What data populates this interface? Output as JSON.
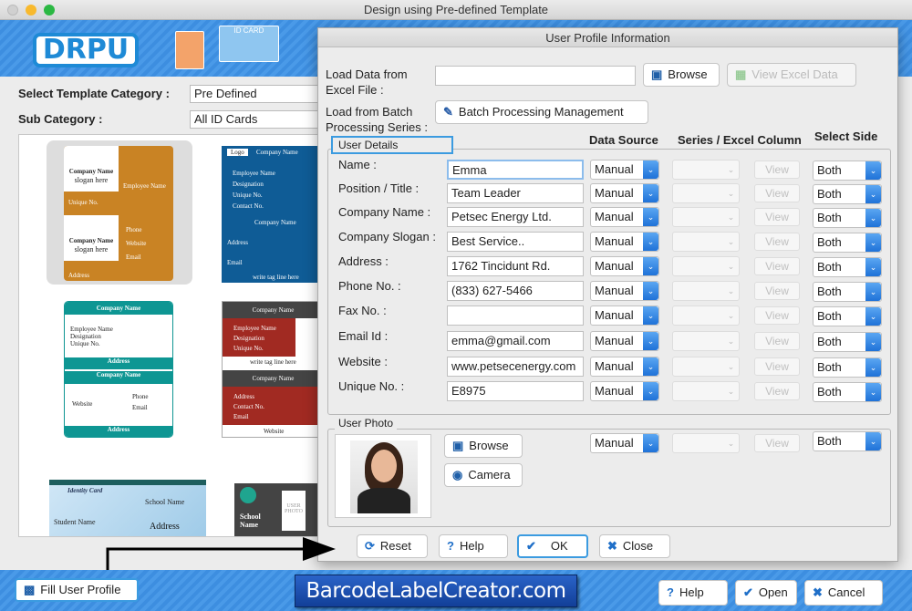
{
  "window": {
    "title": "Design using Pre-defined Template"
  },
  "brand": {
    "logo": "DRPU",
    "id_card_label": "ID CARD",
    "accent": "#1e8ad6"
  },
  "left": {
    "template_category_label": "Select Template Category :",
    "template_category_value": "Pre Defined",
    "sub_category_label": "Sub Category :",
    "sub_category_value": "All ID Cards",
    "templates": [
      {
        "lines": [
          "Company Name",
          "slogan here",
          "Employee Name",
          "Unique No.",
          "Designation",
          "Phone",
          "Website",
          "Email",
          "Address"
        ]
      },
      {
        "lines": [
          "Logo",
          "Company Name",
          "Employee Name",
          "Designation",
          "Unique No.",
          "Contact No.",
          "Address",
          "Email",
          "write tag line here"
        ]
      },
      {
        "lines": [
          "Company Name",
          "Employee Name",
          "Designation",
          "Unique No.",
          "Address",
          "Website",
          "Phone",
          "Email"
        ]
      },
      {
        "lines": [
          "Company Name",
          "Employee Name",
          "Designation",
          "Unique No.",
          "write tag line here",
          "Address",
          "Contact No.",
          "Email",
          "Website"
        ]
      },
      {
        "lines": [
          "Identity Card",
          "School Name",
          "Student Name",
          "Address"
        ]
      },
      {
        "lines": [
          "School Name",
          "USER PHOTO"
        ]
      }
    ]
  },
  "dialog": {
    "title": "User Profile Information",
    "excel_label": "Load Data from Excel File :",
    "excel_value": "",
    "browse_label": "Browse",
    "view_excel_label": "View Excel Data",
    "batch_label": "Load from Batch Processing Series :",
    "batch_button": "Batch Processing Management",
    "user_details_label": "User Details",
    "col_data_source": "Data Source",
    "col_series": "Series / Excel Column",
    "col_side": "Select Side",
    "view_label": "View",
    "fields": [
      {
        "label": "Name :",
        "value": "Emma",
        "source": "Manual",
        "side": "Both"
      },
      {
        "label": "Position / Title :",
        "value": "Team Leader",
        "source": "Manual",
        "side": "Both"
      },
      {
        "label": "Company Name :",
        "value": "Petsec Energy Ltd.",
        "source": "Manual",
        "side": "Both"
      },
      {
        "label": "Company Slogan :",
        "value": "Best Service..",
        "source": "Manual",
        "side": "Both"
      },
      {
        "label": "Address :",
        "value": "1762 Tincidunt Rd.",
        "source": "Manual",
        "side": "Both"
      },
      {
        "label": "Phone No. :",
        "value": "(833) 627-5466",
        "source": "Manual",
        "side": "Both"
      },
      {
        "label": "Fax No. :",
        "value": "",
        "source": "Manual",
        "side": "Both"
      },
      {
        "label": "Email Id :",
        "value": "emma@gmail.com",
        "source": "Manual",
        "side": "Both"
      },
      {
        "label": "Website :",
        "value": "www.petsecenergy.com",
        "source": "Manual",
        "side": "Both"
      },
      {
        "label": "Unique No. :",
        "value": "E8975",
        "source": "Manual",
        "side": "Both"
      }
    ],
    "photo": {
      "label": "User Photo",
      "browse": "Browse",
      "camera": "Camera",
      "source": "Manual",
      "side": "Both"
    },
    "buttons": {
      "reset": "Reset",
      "help": "Help",
      "ok": "OK",
      "close": "Close"
    }
  },
  "bottom": {
    "fill_profile": "Fill User Profile",
    "site": "BarcodeLabelCreator.com",
    "help": "Help",
    "open": "Open",
    "cancel": "Cancel"
  }
}
